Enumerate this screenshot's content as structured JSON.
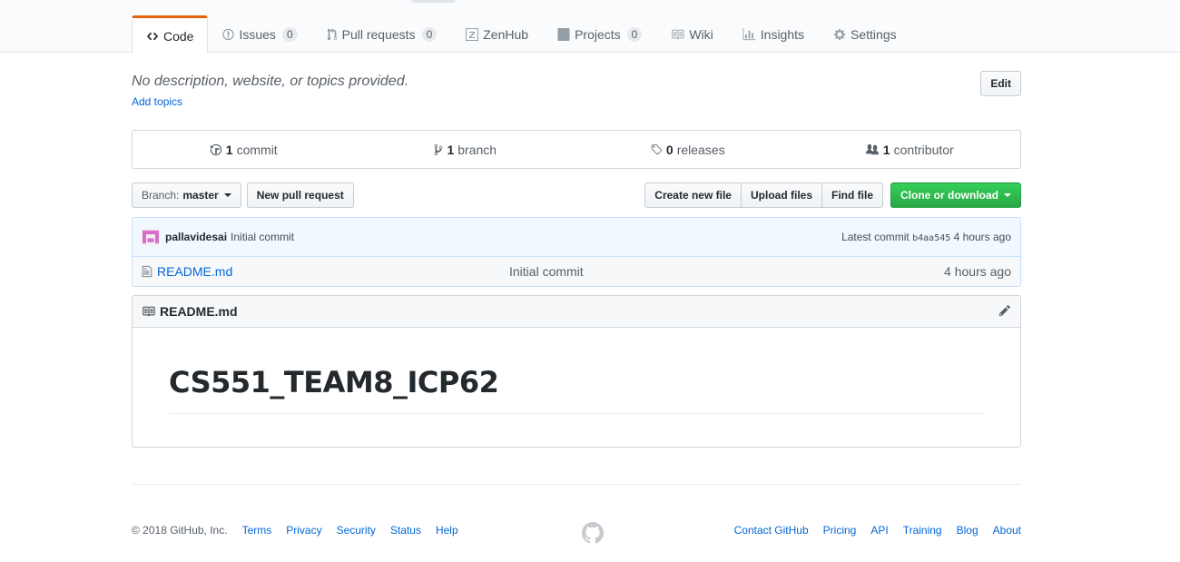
{
  "nav": {
    "tabs": [
      {
        "label": "Code",
        "icon": "code-icon",
        "selected": true
      },
      {
        "label": "Issues",
        "count": "0",
        "icon": "issue-icon"
      },
      {
        "label": "Pull requests",
        "count": "0",
        "icon": "pull-request-icon"
      },
      {
        "label": "ZenHub",
        "icon": "zenhub-icon"
      },
      {
        "label": "Projects",
        "count": "0",
        "icon": "project-icon"
      },
      {
        "label": "Wiki",
        "icon": "book-icon"
      },
      {
        "label": "Insights",
        "icon": "graph-icon"
      },
      {
        "label": "Settings",
        "icon": "gear-icon"
      }
    ]
  },
  "description": {
    "text": "No description, website, or topics provided.",
    "add_topics": "Add topics",
    "edit": "Edit"
  },
  "summary": {
    "commits_num": "1",
    "commits_label": "commit",
    "branches_num": "1",
    "branches_label": "branch",
    "releases_num": "0",
    "releases_label": "releases",
    "contributors_num": "1",
    "contributors_label": "contributor"
  },
  "filebar": {
    "branch_prefix": "Branch:",
    "branch_name": "master",
    "new_pull_request": "New pull request",
    "create_new_file": "Create new file",
    "upload_files": "Upload files",
    "find_file": "Find file",
    "clone_or_download": "Clone or download"
  },
  "commit": {
    "author": "pallavidesai",
    "message": "Initial commit",
    "latest_label": "Latest commit",
    "sha": "b4aa545",
    "age": "4 hours ago"
  },
  "files": [
    {
      "name": "README.md",
      "message": "Initial commit",
      "age": "4 hours ago"
    }
  ],
  "readme": {
    "title": "README.md",
    "heading": "CS551_TEAM8_ICP62"
  },
  "footer": {
    "copyright": "© 2018 GitHub, Inc.",
    "left_links": [
      "Terms",
      "Privacy",
      "Security",
      "Status",
      "Help"
    ],
    "right_links": [
      "Contact GitHub",
      "Pricing",
      "API",
      "Training",
      "Blog",
      "About"
    ]
  },
  "colors": {
    "accent_tab": "#e36209",
    "link": "#0366d6",
    "green_button": "#28a745"
  }
}
